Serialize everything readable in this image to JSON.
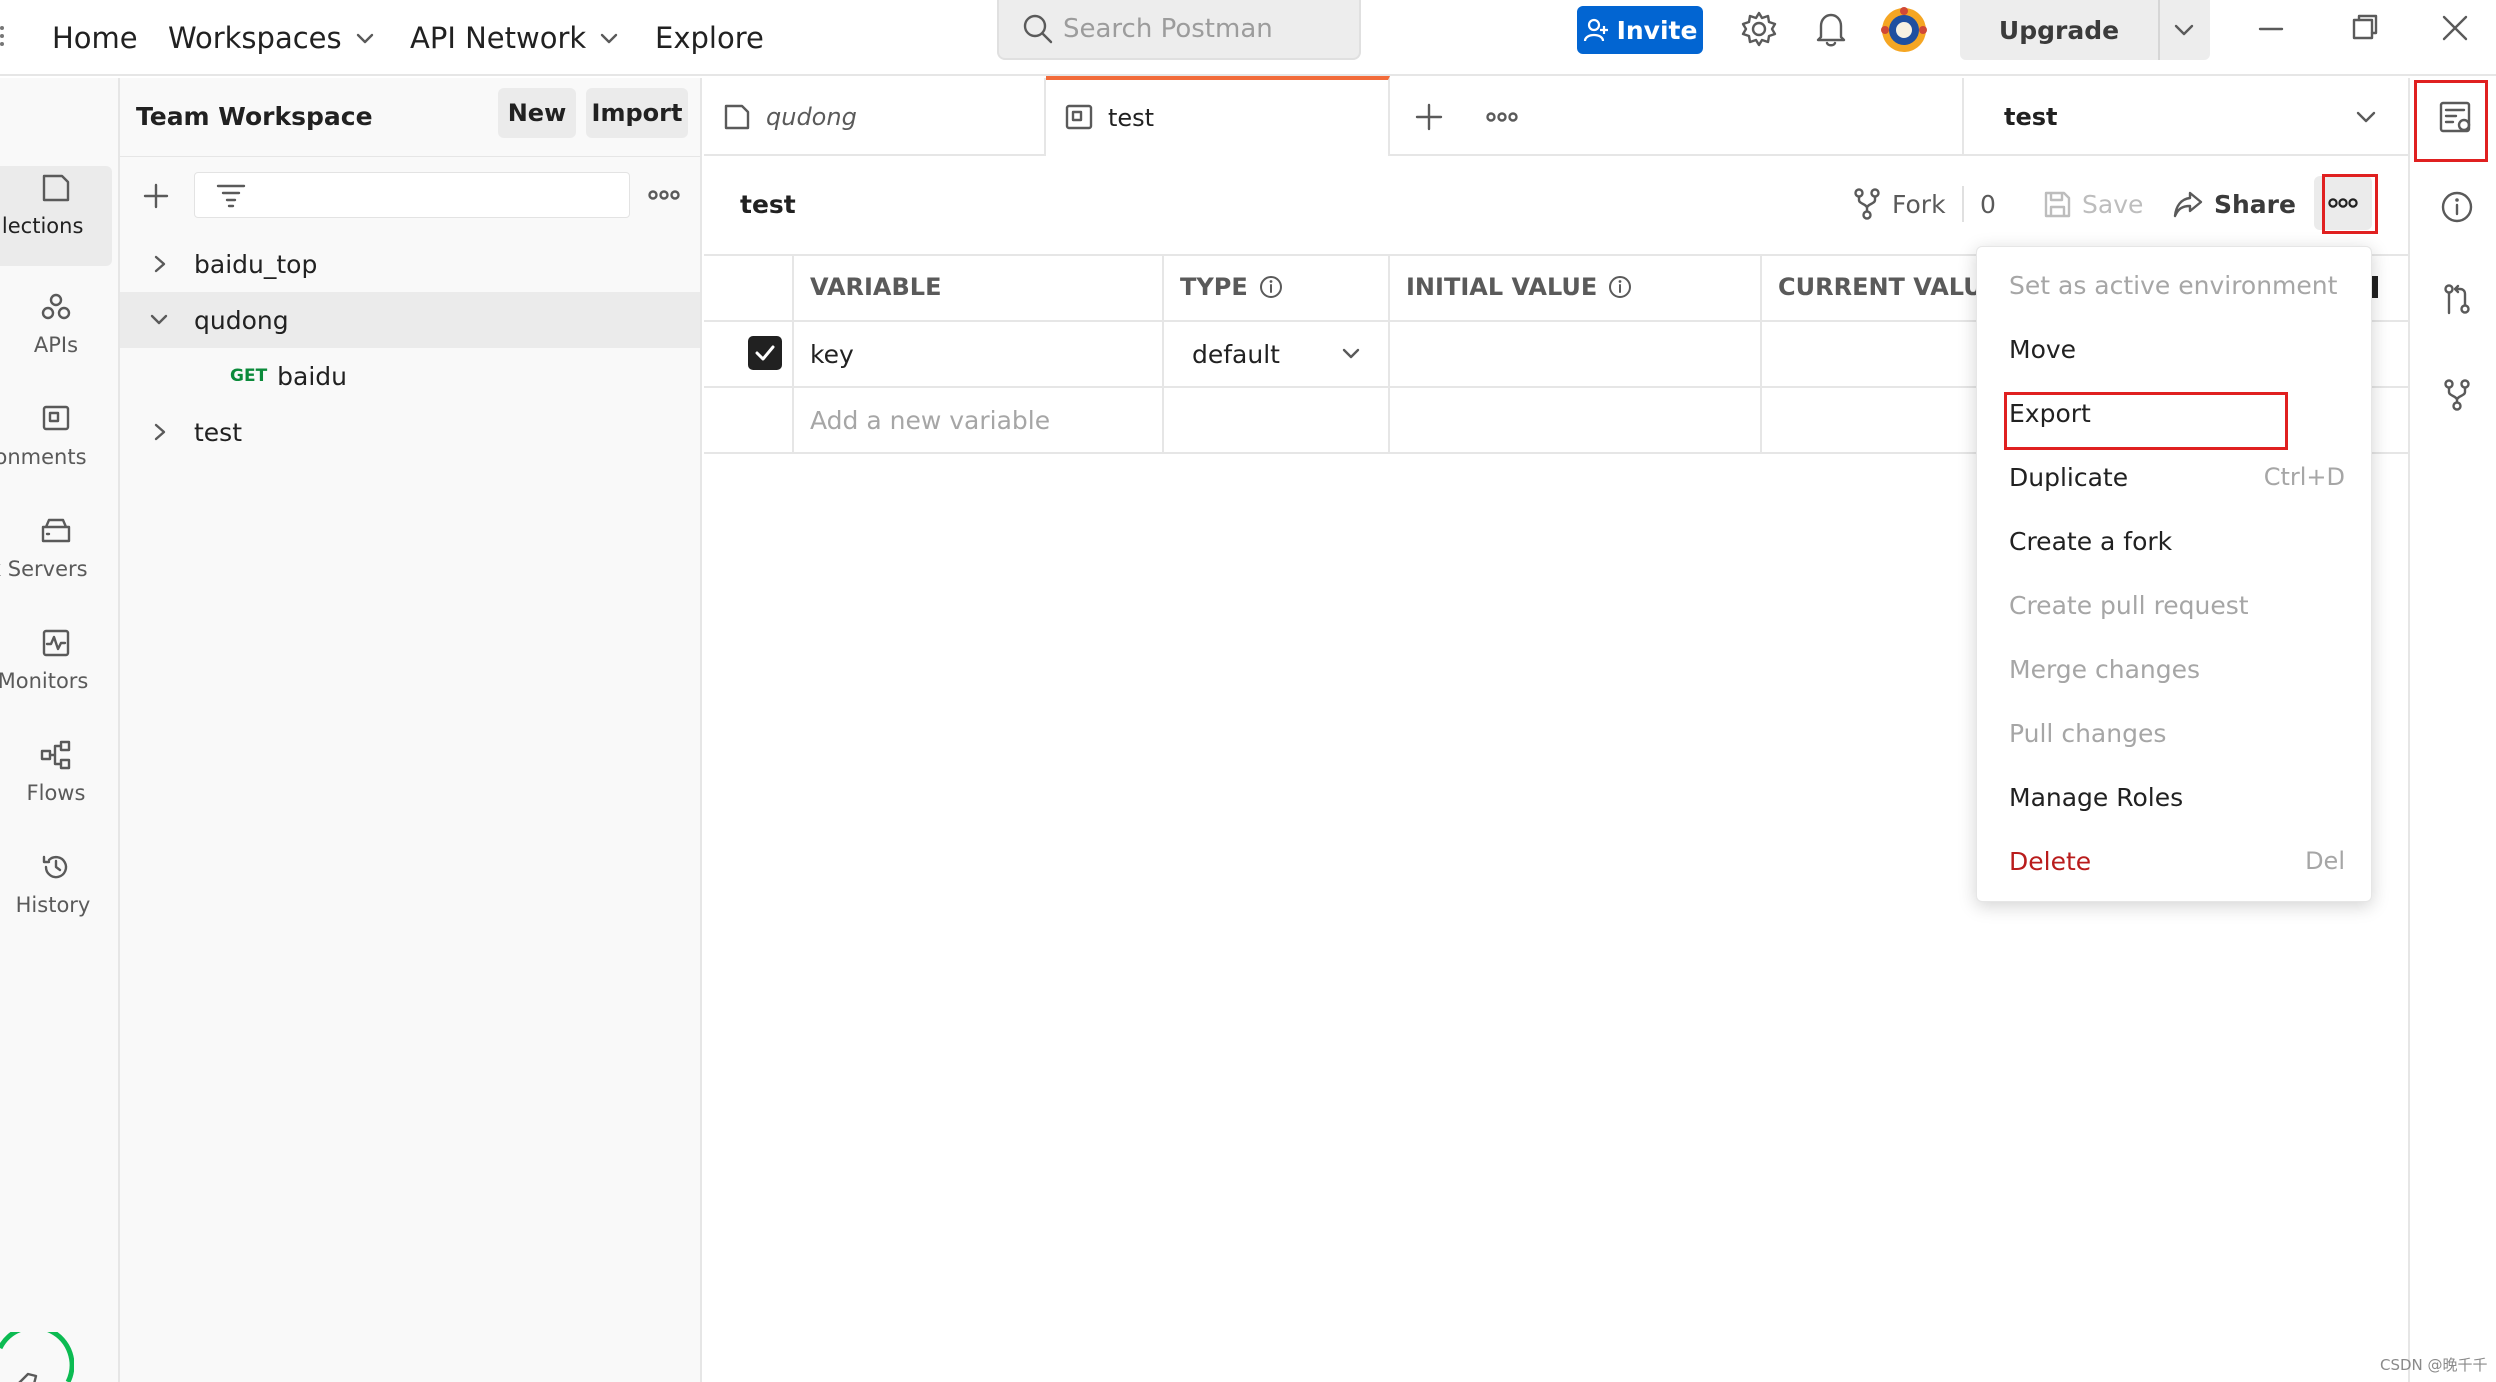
{
  "header": {
    "nav": [
      "Home",
      "Workspaces",
      "API Network",
      "Explore"
    ],
    "search_placeholder": "Search Postman",
    "invite_label": "Invite",
    "upgrade_label": "Upgrade"
  },
  "rail": {
    "items": [
      {
        "label": "Collections",
        "icon": "collections-icon"
      },
      {
        "label": "APIs",
        "icon": "apis-icon"
      },
      {
        "label": "Environments",
        "icon": "environments-icon"
      },
      {
        "label": "Mock Servers",
        "icon": "mock-servers-icon"
      },
      {
        "label": "Monitors",
        "icon": "monitors-icon"
      },
      {
        "label": "Flows",
        "icon": "flows-icon"
      },
      {
        "label": "History",
        "icon": "history-icon"
      }
    ]
  },
  "sidebar": {
    "workspace_title": "Team Workspace",
    "new_label": "New",
    "import_label": "Import",
    "tree": [
      {
        "label": "baidu_top",
        "expanded": false
      },
      {
        "label": "qudong",
        "expanded": true
      },
      {
        "method": "GET",
        "label": "baidu"
      },
      {
        "label": "test",
        "expanded": false
      }
    ]
  },
  "tabs": [
    {
      "label": "qudong",
      "italic": true
    },
    {
      "label": "test",
      "active": true
    }
  ],
  "env_selector": {
    "value": "test"
  },
  "environment": {
    "name": "test",
    "fork_label": "Fork",
    "fork_count": "0",
    "save_label": "Save",
    "share_label": "Share"
  },
  "table": {
    "headers": [
      "VARIABLE",
      "TYPE",
      "INITIAL VALUE",
      "CURRENT VALUE"
    ],
    "rows": [
      {
        "checked": true,
        "variable": "key",
        "type": "default",
        "initial": "",
        "current": ""
      }
    ],
    "add_placeholder": "Add a new variable"
  },
  "menu": {
    "items": [
      {
        "label": "Set as active environment",
        "disabled": true,
        "shortcut": ""
      },
      {
        "label": "Move",
        "disabled": false,
        "shortcut": ""
      },
      {
        "label": "Export",
        "disabled": false,
        "shortcut": ""
      },
      {
        "label": "Duplicate",
        "disabled": false,
        "shortcut": "Ctrl+D"
      },
      {
        "label": "Create a fork",
        "disabled": false,
        "shortcut": ""
      },
      {
        "label": "Create pull request",
        "disabled": true,
        "shortcut": ""
      },
      {
        "label": "Merge changes",
        "disabled": true,
        "shortcut": ""
      },
      {
        "label": "Pull changes",
        "disabled": true,
        "shortcut": ""
      },
      {
        "label": "Manage Roles",
        "disabled": false,
        "shortcut": ""
      },
      {
        "label": "Delete",
        "danger": true,
        "shortcut": "Del"
      }
    ]
  },
  "watermark": "CSDN @晚千千",
  "colors": {
    "accent": "#f26b3a",
    "invite": "#0265d2",
    "highlight": "#e02020",
    "danger": "#b91c1c"
  }
}
